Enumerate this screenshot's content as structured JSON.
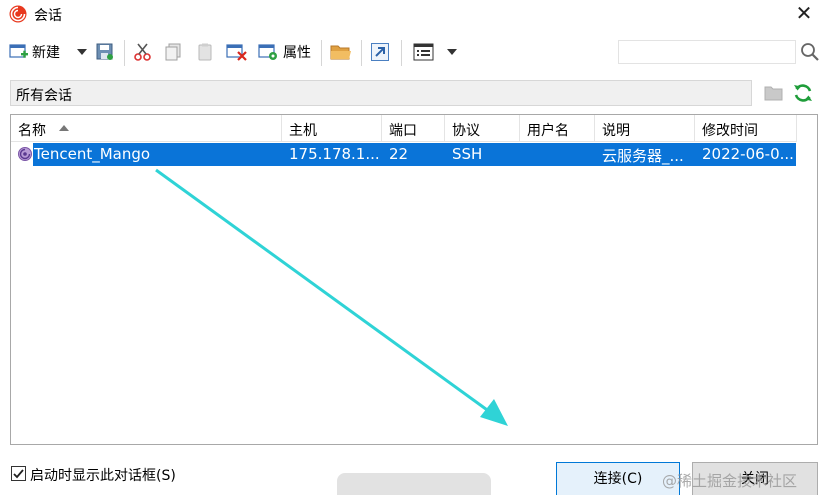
{
  "window": {
    "title": "会话",
    "close_glyph": "✕"
  },
  "toolbar": {
    "new_label": "新建",
    "properties_label": "属性"
  },
  "search": {
    "placeholder": ""
  },
  "path": {
    "label": "所有会话"
  },
  "table": {
    "columns": [
      "名称",
      "主机",
      "端口",
      "协议",
      "用户名",
      "说明",
      "修改时间"
    ],
    "rows": [
      {
        "name": "Tencent_Mango",
        "host": "175.178.1...",
        "port": "22",
        "protocol": "SSH",
        "username": "",
        "description": "云服务器_...",
        "modified": "2022-06-0..."
      }
    ]
  },
  "footer": {
    "startup_checkbox_label": "启动时显示此对话框(S)",
    "startup_checked": true,
    "connect_label": "连接(C)",
    "close_label": "关闭",
    "watermark": "@稀土掘金技术社区"
  },
  "colors": {
    "selection": "#0a74d8",
    "accent_arrow": "#2fd3d6",
    "app_icon": "#e8391f"
  }
}
